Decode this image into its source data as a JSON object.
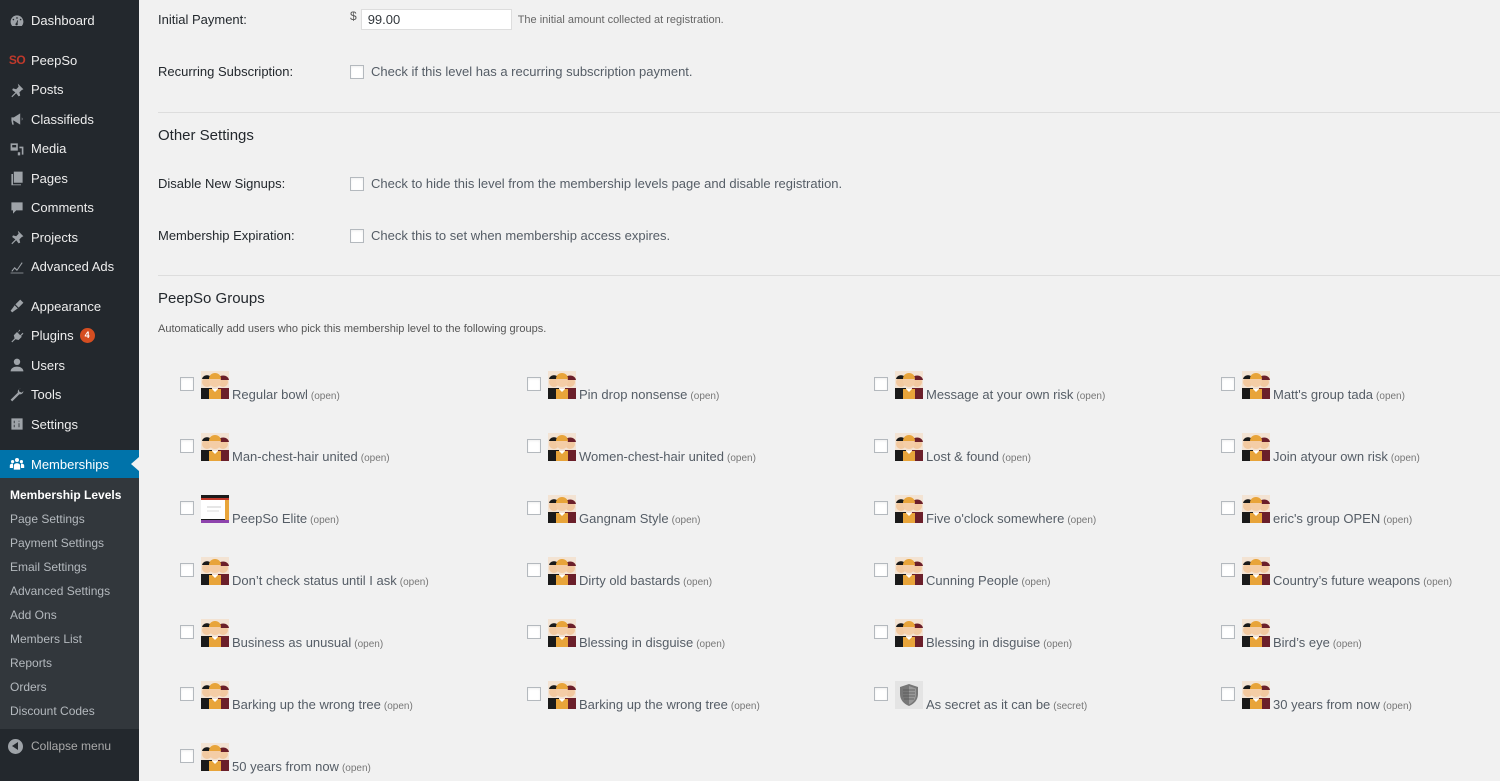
{
  "sidebar": {
    "items": [
      {
        "label": "Dashboard",
        "icon": "dashboard-icon"
      },
      {
        "label": "PeepSo",
        "icon": "peepso-logo",
        "logo_text": "SO"
      },
      {
        "label": "Posts",
        "icon": "pin-icon"
      },
      {
        "label": "Classifieds",
        "icon": "megaphone-icon"
      },
      {
        "label": "Media",
        "icon": "media-icon"
      },
      {
        "label": "Pages",
        "icon": "pages-icon"
      },
      {
        "label": "Comments",
        "icon": "comment-icon"
      },
      {
        "label": "Projects",
        "icon": "pin-icon"
      },
      {
        "label": "Advanced Ads",
        "icon": "chart-icon"
      },
      {
        "label": "Appearance",
        "icon": "brush-icon"
      },
      {
        "label": "Plugins",
        "icon": "plug-icon",
        "badge": "4"
      },
      {
        "label": "Users",
        "icon": "user-icon"
      },
      {
        "label": "Tools",
        "icon": "wrench-icon"
      },
      {
        "label": "Settings",
        "icon": "settings-icon"
      },
      {
        "label": "Memberships",
        "icon": "group-icon"
      }
    ],
    "submenu": [
      "Membership Levels",
      "Page Settings",
      "Payment Settings",
      "Email Settings",
      "Advanced Settings",
      "Add Ons",
      "Members List",
      "Reports",
      "Orders",
      "Discount Codes"
    ],
    "collapse_label": "Collapse menu"
  },
  "form": {
    "initial_payment": {
      "label": "Initial Payment:",
      "currency": "$",
      "value": "99.00",
      "description": "The initial amount collected at registration."
    },
    "recurring": {
      "label": "Recurring Subscription:",
      "description": "Check if this level has a recurring subscription payment.",
      "checked": false
    },
    "other_settings_title": "Other Settings",
    "disable_signups": {
      "label": "Disable New Signups:",
      "description": "Check to hide this level from the membership levels page and disable registration.",
      "checked": false
    },
    "expiration": {
      "label": "Membership Expiration:",
      "description": "Check this to set when membership access expires.",
      "checked": false
    }
  },
  "groups_section": {
    "title": "PeepSo Groups",
    "description": "Automatically add users who pick this membership level to the following groups.",
    "groups": [
      {
        "name": "Regular bowl",
        "privacy": "(open)",
        "avatar": "people"
      },
      {
        "name": "Pin drop nonsense",
        "privacy": "(open)",
        "avatar": "people"
      },
      {
        "name": "Message at your own risk",
        "privacy": "(open)",
        "avatar": "people"
      },
      {
        "name": "Matt's group tada",
        "privacy": "(open)",
        "avatar": "people"
      },
      {
        "name": "Man-chest-hair united",
        "privacy": "(open)",
        "avatar": "people"
      },
      {
        "name": "Women-chest-hair united",
        "privacy": "(open)",
        "avatar": "people"
      },
      {
        "name": "Lost & found",
        "privacy": "(open)",
        "avatar": "people"
      },
      {
        "name": "Join atyour own risk",
        "privacy": "(open)",
        "avatar": "people"
      },
      {
        "name": "PeepSo Elite",
        "privacy": "(open)",
        "avatar": "screenshot"
      },
      {
        "name": "Gangnam Style",
        "privacy": "(open)",
        "avatar": "people"
      },
      {
        "name": "Five o'clock somewhere",
        "privacy": "(open)",
        "avatar": "people"
      },
      {
        "name": "eric's group OPEN",
        "privacy": "(open)",
        "avatar": "people"
      },
      {
        "name": "Don’t check status until I ask",
        "privacy": "(open)",
        "avatar": "people"
      },
      {
        "name": "Dirty old bastards",
        "privacy": "(open)",
        "avatar": "people"
      },
      {
        "name": "Cunning People",
        "privacy": "(open)",
        "avatar": "people"
      },
      {
        "name": "Country’s future weapons",
        "privacy": "(open)",
        "avatar": "people"
      },
      {
        "name": "Business as unusual",
        "privacy": "(open)",
        "avatar": "people"
      },
      {
        "name": "Blessing in disguise",
        "privacy": "(open)",
        "avatar": "people"
      },
      {
        "name": "Blessing in disguise",
        "privacy": "(open)",
        "avatar": "people"
      },
      {
        "name": "Bird’s eye",
        "privacy": "(open)",
        "avatar": "people"
      },
      {
        "name": "Barking up the wrong tree",
        "privacy": "(open)",
        "avatar": "people"
      },
      {
        "name": "Barking up the wrong tree",
        "privacy": "(open)",
        "avatar": "people"
      },
      {
        "name": "As secret as it can be",
        "privacy": "(secret)",
        "avatar": "shield"
      },
      {
        "name": "30 years from now",
        "privacy": "(open)",
        "avatar": "people"
      },
      {
        "name": "50 years from now",
        "privacy": "(open)",
        "avatar": "people"
      }
    ]
  },
  "colors": {
    "sidebar_bg": "#23282d",
    "submenu_bg": "#32373c",
    "accent": "#0073aa",
    "badge": "#d54e21",
    "page_bg": "#f1f1f1"
  }
}
